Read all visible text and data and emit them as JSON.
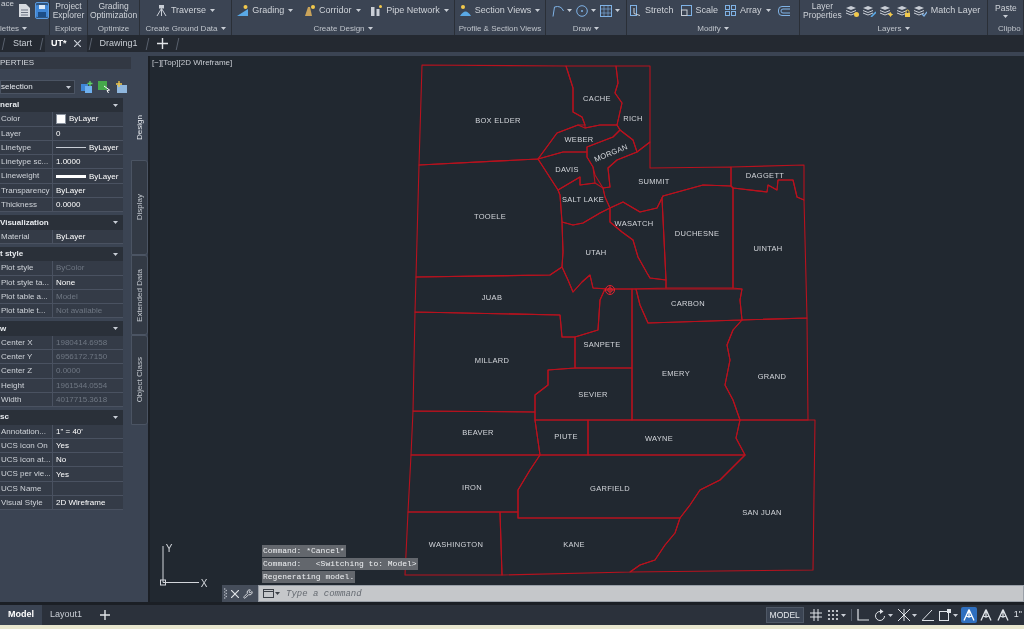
{
  "ribbon": {
    "panels": [
      {
        "label": "lettes",
        "dropdown": true,
        "tools": [
          {
            "kind": "cut",
            "label": "ace"
          },
          {
            "kind": "toggle",
            "on": false
          },
          {
            "kind": "toggle",
            "on": true
          }
        ]
      },
      {
        "label": "Explore",
        "dropdown": false,
        "tools": [
          {
            "kind": "stacked",
            "lines": [
              "Project",
              "Explorer"
            ]
          }
        ]
      },
      {
        "label": "Optimize",
        "dropdown": false,
        "tools": [
          {
            "kind": "stacked",
            "lines": [
              "Grading",
              "Optimization"
            ]
          }
        ]
      },
      {
        "label": "Create Ground Data",
        "dropdown": true,
        "tools": [
          {
            "kind": "menu",
            "label": "Traverse"
          }
        ]
      },
      {
        "label": "Create Design",
        "dropdown": true,
        "tools": [
          {
            "kind": "menu",
            "label": "Grading"
          },
          {
            "kind": "menu",
            "label": "Corridor"
          },
          {
            "kind": "menu",
            "label": "Pipe Network"
          }
        ]
      },
      {
        "label": "Profile & Section Views",
        "dropdown": false,
        "tools": [
          {
            "kind": "menu",
            "label": "Section Views"
          }
        ]
      },
      {
        "label": "Draw",
        "dropdown": true,
        "tools": [
          {
            "kind": "icon_menu"
          },
          {
            "kind": "icon_menu"
          },
          {
            "kind": "icon_menu"
          }
        ]
      },
      {
        "label": "Modify",
        "dropdown": true,
        "tools": [
          {
            "kind": "button",
            "label": "Stretch"
          },
          {
            "kind": "button",
            "label": "Scale"
          },
          {
            "kind": "menu",
            "label": "Array"
          },
          {
            "kind": "icon"
          }
        ]
      },
      {
        "label": "Layers",
        "dropdown": true,
        "tools": [
          {
            "kind": "stacked",
            "lines": [
              "Layer",
              "Properties"
            ]
          },
          {
            "kind": "icon"
          },
          {
            "kind": "icon"
          },
          {
            "kind": "icon"
          },
          {
            "kind": "icon"
          },
          {
            "kind": "button",
            "label": "Match Layer"
          }
        ]
      },
      {
        "label": "Clipbo",
        "dropdown": false,
        "tools": [
          {
            "kind": "stacked_menu",
            "lines": [
              "Paste"
            ]
          }
        ]
      }
    ]
  },
  "document_tabs": [
    {
      "label": "Start",
      "selected": false
    },
    {
      "label": "UT*",
      "selected": true
    },
    {
      "label": "Drawing1",
      "selected": false
    }
  ],
  "properties": {
    "title": "PERTIES",
    "selection": "selection",
    "sections": [
      {
        "title": "neral",
        "expanded": true,
        "rows": [
          {
            "label": "Color",
            "value": "ByLayer",
            "kind": "color",
            "disabled": false
          },
          {
            "label": "Layer",
            "value": "0",
            "kind": "text",
            "disabled": false
          },
          {
            "label": "Linetype",
            "value": "ByLayer",
            "kind": "linetype",
            "disabled": false
          },
          {
            "label": "Linetype sc...",
            "value": "1.0000",
            "kind": "text",
            "disabled": false
          },
          {
            "label": "Lineweight",
            "value": "ByLayer",
            "kind": "lineweight",
            "disabled": false
          },
          {
            "label": "Transparency",
            "value": "ByLayer",
            "kind": "text",
            "disabled": false
          },
          {
            "label": "Thickness",
            "value": "0.0000",
            "kind": "text",
            "disabled": false
          }
        ]
      },
      {
        "title": "Visualization",
        "expanded": true,
        "rows": [
          {
            "label": "Material",
            "value": "ByLayer",
            "kind": "text",
            "disabled": false
          }
        ]
      },
      {
        "title": "t style",
        "expanded": true,
        "rows": [
          {
            "label": "Plot style",
            "value": "ByColor",
            "kind": "text",
            "disabled": true
          },
          {
            "label": "Plot style ta...",
            "value": "None",
            "kind": "text",
            "disabled": false
          },
          {
            "label": "Plot table a...",
            "value": "Model",
            "kind": "text",
            "disabled": true
          },
          {
            "label": "Plot table t...",
            "value": "Not available",
            "kind": "text",
            "disabled": true
          }
        ]
      },
      {
        "title": "w",
        "expanded": true,
        "rows": [
          {
            "label": "Center X",
            "value": "1980414.6958",
            "kind": "text",
            "disabled": true
          },
          {
            "label": "Center Y",
            "value": "6956172.7150",
            "kind": "text",
            "disabled": true
          },
          {
            "label": "Center Z",
            "value": "0.0000",
            "kind": "text",
            "disabled": true
          },
          {
            "label": "Height",
            "value": "1961544.0554",
            "kind": "text",
            "disabled": true
          },
          {
            "label": "Width",
            "value": "4017715.3618",
            "kind": "text",
            "disabled": true
          }
        ]
      },
      {
        "title": "sc",
        "expanded": true,
        "rows": [
          {
            "label": "Annotation...",
            "value": "1\" = 40'",
            "kind": "text",
            "disabled": false
          },
          {
            "label": "UCS icon On",
            "value": "Yes",
            "kind": "text",
            "disabled": false
          },
          {
            "label": "UCS icon at...",
            "value": "No",
            "kind": "text",
            "disabled": false
          },
          {
            "label": "UCS per vie...",
            "value": "Yes",
            "kind": "text",
            "disabled": false
          },
          {
            "label": "UCS Name",
            "kind": "text"
          },
          {
            "label": "Visual Style",
            "value": "2D Wireframe",
            "kind": "text",
            "disabled": false
          }
        ]
      }
    ],
    "tabs": [
      {
        "label": "Design",
        "selected": true
      },
      {
        "label": "Display",
        "selected": false
      },
      {
        "label": "Extended Data",
        "selected": false
      },
      {
        "label": "Object Class",
        "selected": false
      }
    ]
  },
  "viewport": {
    "controls": "[−][Top][2D Wireframe]",
    "counties": [
      {
        "name": "CACHE"
      },
      {
        "name": "RICH"
      },
      {
        "name": "BOX ELDER"
      },
      {
        "name": "WEBER"
      },
      {
        "name": "MORGAN"
      },
      {
        "name": "DAVIS"
      },
      {
        "name": "DAGGETT"
      },
      {
        "name": "SUMMIT"
      },
      {
        "name": "SALT LAKE"
      },
      {
        "name": "TOOELE"
      },
      {
        "name": "WASATCH"
      },
      {
        "name": "DUCHESNE"
      },
      {
        "name": "UINTAH"
      },
      {
        "name": "UTAH"
      },
      {
        "name": "JUAB"
      },
      {
        "name": "CARBON"
      },
      {
        "name": "SANPETE"
      },
      {
        "name": "MILLARD"
      },
      {
        "name": "EMERY"
      },
      {
        "name": "GRAND"
      },
      {
        "name": "SEVIER"
      },
      {
        "name": "BEAVER"
      },
      {
        "name": "PIUTE"
      },
      {
        "name": "WAYNE"
      },
      {
        "name": "IRON"
      },
      {
        "name": "GARFIELD"
      },
      {
        "name": "SAN JUAN"
      },
      {
        "name": "WASHINGTON"
      },
      {
        "name": "KANE"
      }
    ],
    "ucs": {
      "y": "Y",
      "x": "X"
    }
  },
  "command_line": {
    "history": [
      "Command: *Cancel*",
      "Command:   <Switching to: Model>",
      "Regenerating model."
    ],
    "placeholder": "Type a command"
  },
  "layout_tabs": [
    {
      "label": "Model",
      "selected": true
    },
    {
      "label": "Layout1",
      "selected": false
    }
  ],
  "status_bar": {
    "space": "MODEL",
    "tools": [
      {
        "kind": "grid",
        "on": false,
        "dropdown": false
      },
      {
        "kind": "snap",
        "on": false,
        "dropdown": true
      },
      {
        "kind": "ortho",
        "on": false,
        "dropdown": false
      },
      {
        "kind": "polar",
        "on": false,
        "dropdown": true
      },
      {
        "kind": "isodraft",
        "on": false,
        "dropdown": true
      },
      {
        "kind": "angle",
        "on": false,
        "dropdown": false
      },
      {
        "kind": "osnap",
        "on": false,
        "dropdown": true
      },
      {
        "kind": "visibility",
        "on": true,
        "dropdown": false
      },
      {
        "kind": "autoscale",
        "on": false,
        "dropdown": false
      },
      {
        "kind": "annoscale",
        "on": false,
        "dropdown": false
      }
    ],
    "scale": "1\""
  }
}
